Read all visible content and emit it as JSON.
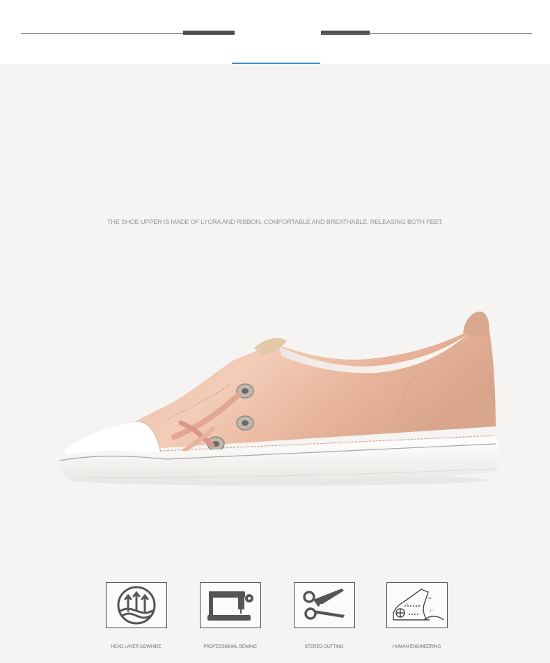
{
  "banner": {
    "caption": "THE SHOE UPPER IS MADE OF LYCRA AND RIBBON, COMFORTABLE AND BREATHABLE, RELEASING BOTH FEET."
  },
  "product_image": {
    "subject": "pink satin lace-up sneaker",
    "colors": {
      "upper": "#e8bba3",
      "toe_cap": "#ffffff",
      "sole": "#f2f2f0",
      "eyelet": "#b9b3ad"
    }
  },
  "features": [
    {
      "icon": "arrows-up-icon",
      "label": "HEAD LAYER COWHIDE"
    },
    {
      "icon": "sewing-machine-icon",
      "label": "PROFESSIONAL SEWING"
    },
    {
      "icon": "scissors-icon",
      "label": "STEREO CUTTING"
    },
    {
      "icon": "foot-diagram-icon",
      "label": "HUMAN ENGINEERING"
    }
  ]
}
